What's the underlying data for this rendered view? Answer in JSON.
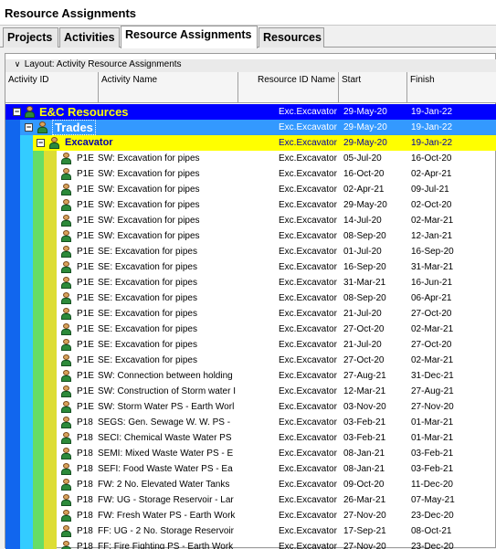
{
  "window": {
    "title": "Resource Assignments"
  },
  "tabs": [
    {
      "label": "Projects",
      "active": false
    },
    {
      "label": "Activities",
      "active": false
    },
    {
      "label": "Resource Assignments",
      "active": true
    },
    {
      "label": "Resources",
      "active": false
    }
  ],
  "layout_label": "Layout: Activity Resource Assignments",
  "columns": {
    "activity_id": "Activity ID",
    "activity_name": "Activity Name",
    "resource_id_name": "Resource ID Name",
    "start": "Start",
    "finish": "Finish"
  },
  "colors": {
    "level1": "#0000ff",
    "level2": "#3399ff",
    "level3": "#ffff00",
    "rail_blue": "#1166ee",
    "rail_cyan": "#33ccff",
    "rail_green": "#66dd66",
    "rail_yellow": "#dddd33"
  },
  "groups": [
    {
      "name": "E&C Resources",
      "resource": "Exc.Excavator",
      "start": "29-May-20",
      "finish": "19-Jan-22"
    },
    {
      "name": "Trades",
      "resource": "Exc.Excavator",
      "start": "29-May-20",
      "finish": "19-Jan-22"
    },
    {
      "name": "Excavator",
      "resource": "Exc.Excavator",
      "start": "29-May-20",
      "finish": "19-Jan-22"
    }
  ],
  "rows": [
    {
      "id": "P1E",
      "name": "SW: Excavation for pipes",
      "resource": "Exc.Excavator",
      "start": "05-Jul-20",
      "finish": "16-Oct-20"
    },
    {
      "id": "P1E",
      "name": "SW: Excavation for pipes",
      "resource": "Exc.Excavator",
      "start": "16-Oct-20",
      "finish": "02-Apr-21"
    },
    {
      "id": "P1E",
      "name": "SW: Excavation for pipes",
      "resource": "Exc.Excavator",
      "start": "02-Apr-21",
      "finish": "09-Jul-21"
    },
    {
      "id": "P1E",
      "name": "SW: Excavation for pipes",
      "resource": "Exc.Excavator",
      "start": "29-May-20",
      "finish": "02-Oct-20"
    },
    {
      "id": "P1E",
      "name": "SW: Excavation for pipes",
      "resource": "Exc.Excavator",
      "start": "14-Jul-20",
      "finish": "02-Mar-21"
    },
    {
      "id": "P1E",
      "name": "SW: Excavation for pipes",
      "resource": "Exc.Excavator",
      "start": "08-Sep-20",
      "finish": "12-Jan-21"
    },
    {
      "id": "P1E",
      "name": "SE: Excavation for pipes",
      "resource": "Exc.Excavator",
      "start": "01-Jul-20",
      "finish": "16-Sep-20"
    },
    {
      "id": "P1E",
      "name": "SE: Excavation for pipes",
      "resource": "Exc.Excavator",
      "start": "16-Sep-20",
      "finish": "31-Mar-21"
    },
    {
      "id": "P1E",
      "name": "SE: Excavation for pipes",
      "resource": "Exc.Excavator",
      "start": "31-Mar-21",
      "finish": "16-Jun-21"
    },
    {
      "id": "P1E",
      "name": "SE: Excavation for pipes",
      "resource": "Exc.Excavator",
      "start": "08-Sep-20",
      "finish": "06-Apr-21"
    },
    {
      "id": "P1E",
      "name": "SE: Excavation for pipes",
      "resource": "Exc.Excavator",
      "start": "21-Jul-20",
      "finish": "27-Oct-20"
    },
    {
      "id": "P1E",
      "name": "SE: Excavation for pipes",
      "resource": "Exc.Excavator",
      "start": "27-Oct-20",
      "finish": "02-Mar-21"
    },
    {
      "id": "P1E",
      "name": "SE: Excavation for pipes",
      "resource": "Exc.Excavator",
      "start": "21-Jul-20",
      "finish": "27-Oct-20"
    },
    {
      "id": "P1E",
      "name": "SE: Excavation for pipes",
      "resource": "Exc.Excavator",
      "start": "27-Oct-20",
      "finish": "02-Mar-21"
    },
    {
      "id": "P1E",
      "name": "SW: Connection between holding",
      "resource": "Exc.Excavator",
      "start": "27-Aug-21",
      "finish": "31-Dec-21"
    },
    {
      "id": "P1E",
      "name": "SW: Construction of Storm water I",
      "resource": "Exc.Excavator",
      "start": "12-Mar-21",
      "finish": "27-Aug-21"
    },
    {
      "id": "P1E",
      "name": "SW: Storm Water PS - Earth Worl",
      "resource": "Exc.Excavator",
      "start": "03-Nov-20",
      "finish": "27-Nov-20"
    },
    {
      "id": "P18",
      "name": "SEGS: Gen. Sewage W. W. PS -",
      "resource": "Exc.Excavator",
      "start": "03-Feb-21",
      "finish": "01-Mar-21"
    },
    {
      "id": "P18",
      "name": "SECI: Chemical Waste Water PS",
      "resource": "Exc.Excavator",
      "start": "03-Feb-21",
      "finish": "01-Mar-21"
    },
    {
      "id": "P18",
      "name": "SEMI: Mixed Waste Water PS - E",
      "resource": "Exc.Excavator",
      "start": "08-Jan-21",
      "finish": "03-Feb-21"
    },
    {
      "id": "P18",
      "name": "SEFI: Food Waste Water PS - Ea",
      "resource": "Exc.Excavator",
      "start": "08-Jan-21",
      "finish": "03-Feb-21"
    },
    {
      "id": "P18",
      "name": "FW: 2 No. Elevated Water Tanks",
      "resource": "Exc.Excavator",
      "start": "09-Oct-20",
      "finish": "11-Dec-20"
    },
    {
      "id": "P18",
      "name": "FW: UG - Storage Reservoir - Lar",
      "resource": "Exc.Excavator",
      "start": "26-Mar-21",
      "finish": "07-May-21"
    },
    {
      "id": "P18",
      "name": "FW: Fresh Water PS - Earth Work",
      "resource": "Exc.Excavator",
      "start": "27-Nov-20",
      "finish": "23-Dec-20"
    },
    {
      "id": "P18",
      "name": "FF: UG - 2 No. Storage Reservoir",
      "resource": "Exc.Excavator",
      "start": "17-Sep-21",
      "finish": "08-Oct-21"
    },
    {
      "id": "P18",
      "name": "FF: Fire Fighting PS - Earth Work",
      "resource": "Exc.Excavator",
      "start": "27-Nov-20",
      "finish": "23-Dec-20"
    }
  ]
}
